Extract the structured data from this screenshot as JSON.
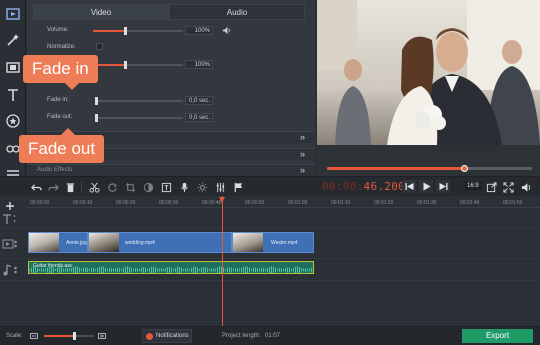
{
  "panel": {
    "tabs": [
      {
        "label": "Video"
      },
      {
        "label": "Audio"
      }
    ],
    "volume": {
      "label": "Volume:",
      "value": "100%",
      "level": 0.35
    },
    "normalize": {
      "label": "Normalize:"
    },
    "speed": {
      "value": "100%",
      "level": 0.35
    },
    "fade_in": {
      "label": "Fade in:",
      "value": "0,0 sec."
    },
    "fade_out": {
      "label": "Fade out:",
      "value": "0,0 sec."
    },
    "collapsed_section": {
      "label": "Audio Effects"
    }
  },
  "callouts": {
    "fade_in": "Fade in",
    "fade_out": "Fade out"
  },
  "preview": {
    "seek_progress": 0.67
  },
  "toolbar": {
    "timecode_dim": "00:00:",
    "timecode_lit": "46.200",
    "aspect_ratio": "16:9"
  },
  "timeline": {
    "ruler_ticks": [
      "00:00:00",
      "00:00:10",
      "00:00:20",
      "00:00:30",
      "00:00:40",
      "00:00:50",
      "00:01:00",
      "00:01:10",
      "00:01:20",
      "00:01:30",
      "00:01:40",
      "00:01:50"
    ],
    "clips": [
      {
        "name": "Annie.jpg"
      },
      {
        "name": "wedding.mp4"
      },
      {
        "name": "Wester.mp4"
      }
    ],
    "audio_clip": {
      "name": "Guitar friends.aac"
    }
  },
  "footer": {
    "scale_label": "Scale:",
    "scale_level": 0.6,
    "notifications_label": "Notifications",
    "project_length_label": "Project length:",
    "project_length_value": "01:07",
    "export_label": "Export"
  },
  "colors": {
    "accent": "#e4553a",
    "callout": "#ee7d57",
    "clip_blue": "#3f6fb5",
    "audio_green": "#1f6e5e",
    "export_green": "#1e9b66"
  }
}
